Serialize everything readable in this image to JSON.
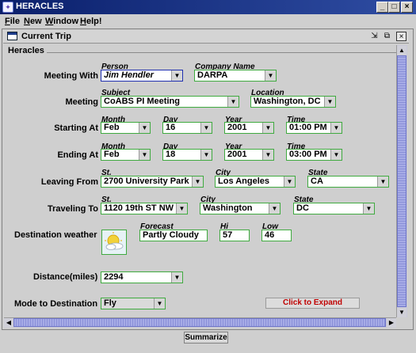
{
  "window": {
    "title": "HERACLES",
    "app_icon": "heracles-app-icon",
    "buttons": [
      "_",
      "□",
      "×"
    ]
  },
  "menu": {
    "items": [
      {
        "label": "File",
        "ul": "F",
        "rest": "ile"
      },
      {
        "label": "New",
        "ul": "N",
        "rest": "ew"
      },
      {
        "label": "Window",
        "ul": "W",
        "rest": "indow"
      },
      {
        "label": "Help!",
        "ul": "H",
        "rest": "elp!"
      }
    ]
  },
  "frame": {
    "title": "Current Trip",
    "group": "Heracles"
  },
  "meeting_with": {
    "label": "Meeting With",
    "person_label": "Person",
    "person": "Jim Hendler",
    "company_label": "Company Name",
    "company": "DARPA"
  },
  "meeting": {
    "label": "Meeting",
    "subject_label": "Subject",
    "subject": "CoABS PI Meeting",
    "location_label": "Location",
    "location": "Washington, DC"
  },
  "starting_at": {
    "label": "Starting At",
    "month_label": "Month",
    "month": "Feb",
    "day_label": "Day",
    "day": "16",
    "year_label": "Year",
    "year": "2001",
    "time_label": "Time",
    "time": "01:00 PM"
  },
  "ending_at": {
    "label": "Ending At",
    "month_label": "Month",
    "month": "Feb",
    "day_label": "Day",
    "day": "18",
    "year_label": "Year",
    "year": "2001",
    "time_label": "Time",
    "time": "03:00 PM"
  },
  "leaving_from": {
    "label": "Leaving From",
    "street_label": "St.",
    "street": "2700 University Park",
    "city_label": "City",
    "city": "Los Angeles",
    "state_label": "State",
    "state": "CA"
  },
  "traveling_to": {
    "label": "Traveling To",
    "street_label": "St.",
    "street": "1120 19th ST NW",
    "city_label": "City",
    "city": "Washington",
    "state_label": "State",
    "state": "DC"
  },
  "weather": {
    "label": "Destination weather",
    "icon": "partly-cloudy-icon",
    "forecast_label": "Forecast",
    "forecast": "Partly Cloudy",
    "hi_label": "Hi",
    "hi": "57",
    "low_label": "Low",
    "low": "46"
  },
  "distance": {
    "label": "Distance(miles)",
    "value": "2294"
  },
  "mode": {
    "label": "Mode to Destination",
    "value": "Fly"
  },
  "expand_button": "Click to Expand",
  "summarize_button": "Summarize",
  "colors": {
    "field_border": "#3faa3f",
    "expand_text": "#c00000",
    "titlebar": "#0a1f6b"
  }
}
